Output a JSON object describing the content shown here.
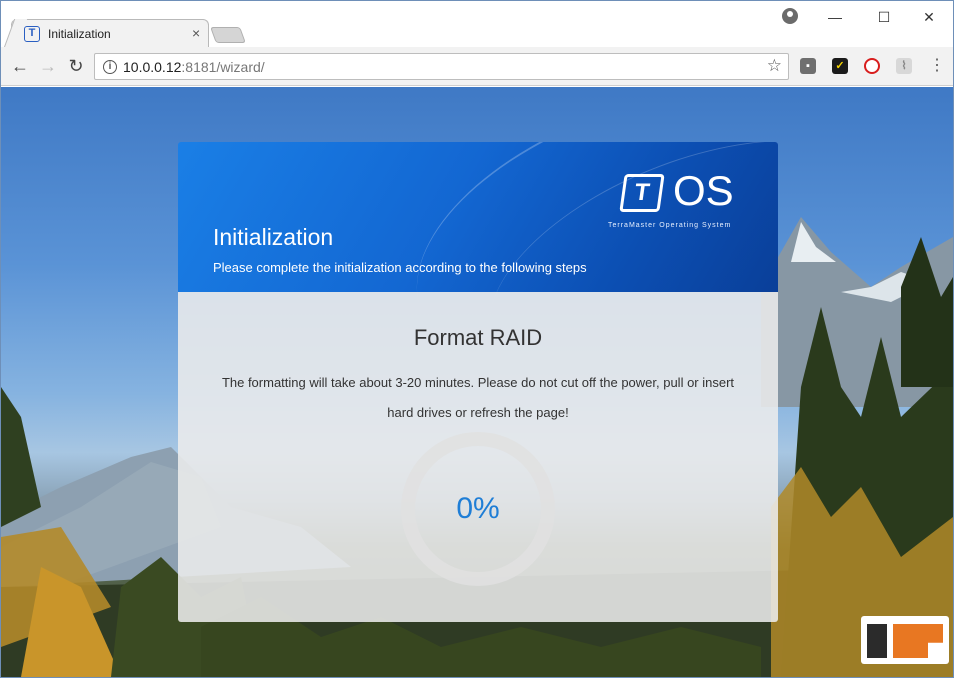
{
  "browser": {
    "tab_title": "Initialization",
    "url_host": "10.0.0.12",
    "url_rest": ":8181/wizard/"
  },
  "icons": {
    "favicon": "terramaster-t-icon",
    "info": "info-icon",
    "star": "bookmark-star-icon",
    "menu": "kebab-menu-icon"
  },
  "header": {
    "logo_letter": "T",
    "logo_text": "OS",
    "logo_subtitle": "TerraMaster Operating System",
    "title": "Initialization",
    "subtitle": "Please complete the initialization according to the following steps"
  },
  "body": {
    "title": "Format RAID",
    "message": "The formatting will take about 3-20 minutes. Please do not cut off the power, pull or insert hard drives or refresh the page!",
    "progress_text": "0%",
    "progress_value": 0
  },
  "colors": {
    "accent": "#1f7ed6",
    "header_blue": "#1367d2"
  }
}
